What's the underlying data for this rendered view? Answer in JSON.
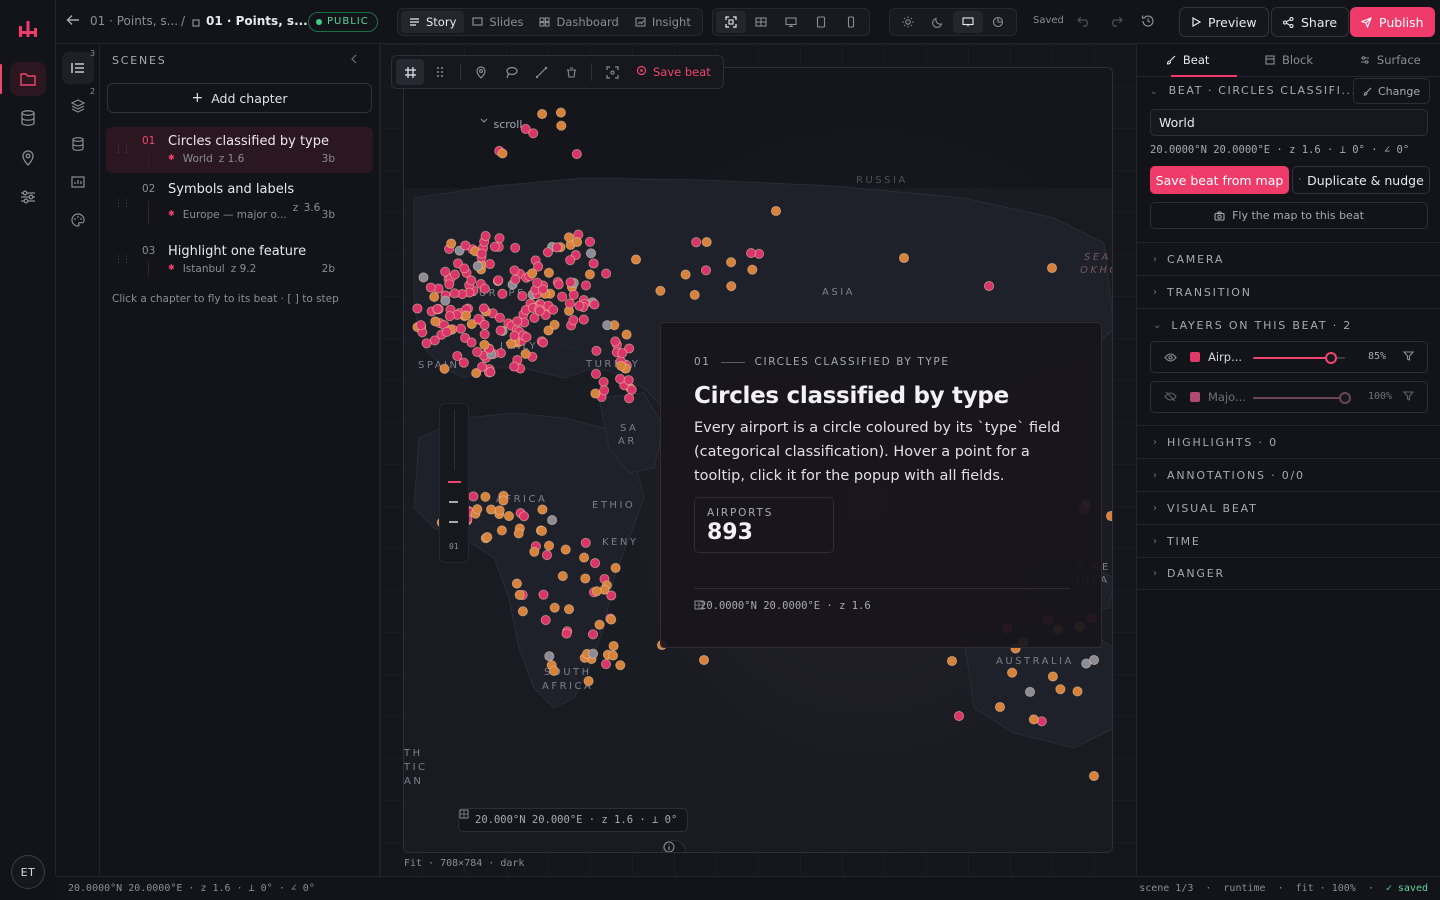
{
  "topbar": {
    "back_crumb": "01 · Points, s...",
    "separator": "/",
    "current_crumb": "01 · Points, s...",
    "visibility": "PUBLIC",
    "view_modes": [
      "Story",
      "Slides",
      "Dashboard",
      "Insight"
    ],
    "active_view": "Story",
    "saved_label": "Saved",
    "preview_label": "Preview",
    "share_label": "Share",
    "publish_label": "Publish"
  },
  "rail": {
    "avatar_initials": "ET",
    "subrail_badges": [
      "3",
      "2"
    ]
  },
  "scenes": {
    "title": "SCENES",
    "add_chapter_label": "Add chapter",
    "chapters": [
      {
        "num": "01",
        "title": "Circles classified by type",
        "place": "World",
        "zoom": "z 1.6",
        "time": "3b"
      },
      {
        "num": "02",
        "title": "Symbols and labels",
        "place": "Europe — major o...",
        "zoom": "z 3.6",
        "time": "3b"
      },
      {
        "num": "03",
        "title": "Highlight one feature",
        "place": "Istanbul",
        "zoom": "z 9.2",
        "time": "2b"
      }
    ],
    "hint": "Click a chapter to fly to its beat · [ ] to step"
  },
  "map": {
    "toolbar_save_label": "Save beat",
    "scroll_label": "scroll",
    "zoom_label": "01",
    "coords_label": "20.000°N  20.000°E  ·  z 1.6  ·  ⟂ 0°",
    "footer": "Fit · 708×784 · dark",
    "place_labels": [
      "RUSSIA",
      "ASIA",
      "EUROPE",
      "ITALY",
      "SPAIN",
      "TURKEY",
      "SA",
      "AR",
      "AFRICA",
      "ETHIO",
      "KENY",
      "SOUTH",
      "AFRICA",
      "AUSTRALIA",
      "SEA",
      "OKHO",
      "A NE",
      "INEA",
      "TH",
      "TIC",
      "AN"
    ]
  },
  "story_card": {
    "eyebrow_num": "01",
    "eyebrow": "CIRCLES CLASSIFIED BY TYPE",
    "title": "Circles classified by type",
    "body": "Every airport is a circle coloured by its `type` field (categorical classification). Hover a point for a tooltip, click it for the popup with all fields.",
    "stat_label": "AIRPORTS",
    "stat_value": "893",
    "footer": "20.0000°N  20.0000°E  ·  z 1.6"
  },
  "inspector": {
    "tabs": [
      "Beat",
      "Block",
      "Surface"
    ],
    "active_tab": "Beat",
    "beat_heading": "BEAT · CIRCLES CLASSIFI...",
    "change_label": "Change",
    "place_value": "World",
    "coords": "20.0000°N  20.0000°E  ·  z 1.6  ·  ⟂ 0°  ·  ∠ 0°",
    "save_from_map_label": "Save beat from map",
    "duplicate_label": "Duplicate & nudge",
    "fly_label": "Fly the map to this beat",
    "sections": {
      "camera": "CAMERA",
      "transition": "TRANSITION",
      "layers": "LAYERS ON THIS BEAT · 2",
      "highlights": "HIGHLIGHTS · 0",
      "annotations": "ANNOTATIONS · 0/0",
      "visual_beat": "VISUAL BEAT",
      "time": "TIME",
      "danger": "DANGER"
    },
    "layers": [
      {
        "name": "Airp...",
        "opacity": 0.85,
        "opacity_label": "85%",
        "color": "#e03a6a",
        "visible": true
      },
      {
        "name": "Majo...",
        "opacity": 1.0,
        "opacity_label": "100%",
        "color": "#b04a72",
        "visible": false
      }
    ]
  },
  "statusbar": {
    "left": "20.0000°N  20.0000°E   ·   z 1.6  ·  ⟂ 0°  ·  ∠ 0°",
    "right": [
      "scene 1/3",
      "·",
      "runtime",
      "·",
      "fit · 100%",
      "·",
      "✓ saved"
    ]
  },
  "colors": {
    "accent": "#ef3b69",
    "point_pink": "#d9356a",
    "point_orange": "#d7823a",
    "point_gray": "#8a8d98"
  }
}
